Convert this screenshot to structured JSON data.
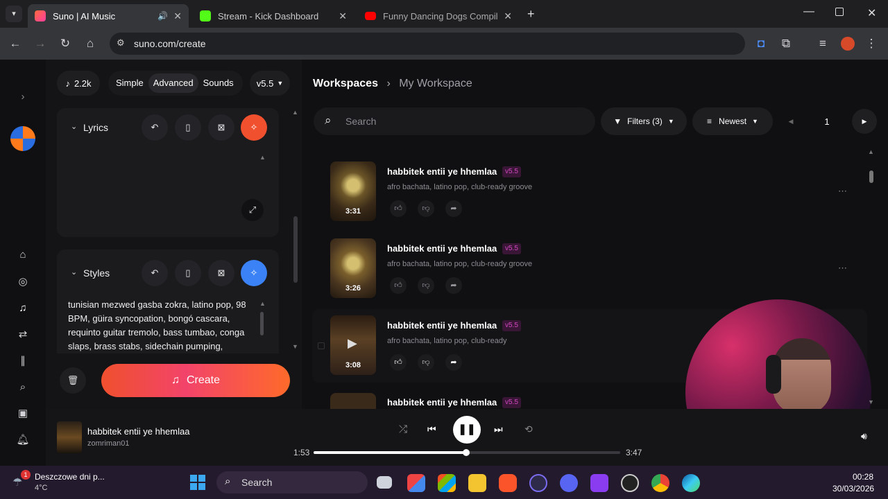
{
  "browser": {
    "tabs": [
      {
        "title": "Suno | AI Music",
        "fav_color": "#ff6a3d",
        "active": true
      },
      {
        "title": "Stream - Kick Dashboard",
        "fav_color": "#53fc18"
      },
      {
        "title": "Funny Dancing Dogs Compilati",
        "fav_color": "#ff0000"
      }
    ],
    "url": "suno.com/create"
  },
  "toolbar": {
    "credits": "2.2k",
    "modes": [
      "Simple",
      "Advanced",
      "Sounds"
    ],
    "active_mode": "Advanced",
    "version": "v5.5"
  },
  "lyrics": {
    "label": "Lyrics"
  },
  "styles": {
    "label": "Styles",
    "text": "tunisian mezwed gasba zokra, latino pop, 98 BPM, güira syncopation, bongó cascara, requinto guitar tremolo, bass tumbao, conga slaps, brass stabs, sidechain pumping,"
  },
  "create_button": "Create",
  "breadcrumb": {
    "root": "Workspaces",
    "current": "My Workspace"
  },
  "search": {
    "placeholder": "Search"
  },
  "filters": {
    "label": "Filters (3)",
    "sort": "Newest",
    "page": "1"
  },
  "songs": [
    {
      "title": "habbitek entii ye hhemlaa",
      "version": "v5.5",
      "tags": "afro bachata, latino pop, club-ready groove",
      "duration": "3:31"
    },
    {
      "title": "habbitek entii ye hhemlaa",
      "version": "v5.5",
      "tags": "afro bachata, latino pop, club-ready groove",
      "duration": "3:26"
    },
    {
      "title": "habbitek entii ye hhemlaa",
      "version": "v5.5",
      "tags": "afro bachata, latino pop, club-ready",
      "duration": "3:08"
    },
    {
      "title": "habbitek entii ye hhemlaa",
      "version": "v5.5",
      "tags": "",
      "duration": ""
    }
  ],
  "player": {
    "title": "habbitek entii ye hhemlaa",
    "artist": "zomriman01",
    "elapsed": "1:53",
    "total": "3:47",
    "progress": 0.498
  },
  "taskbar": {
    "weather_title": "Deszczowe dni p...",
    "weather_temp": "4°C",
    "weather_badge": "1",
    "search": "Search",
    "time": "00:28",
    "date": "30/03/2026"
  },
  "colors": {
    "accent_orange": "#f0502e",
    "accent_blue": "#3b82f6",
    "version_badge": "#d147c0"
  }
}
